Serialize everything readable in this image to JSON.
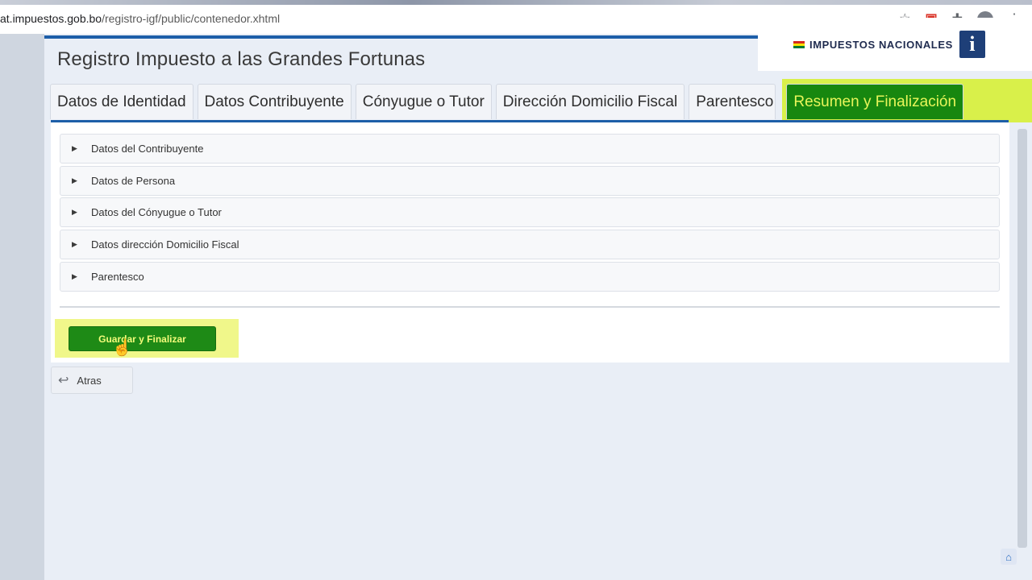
{
  "browser": {
    "url_domain": "at.impuestos.gob.bo",
    "url_path": "/registro-igf/public/contenedor.xhtml",
    "icons": [
      "star-icon",
      "pdf-extension-icon",
      "puzzle-icon",
      "profile-icon",
      "menu-icon"
    ]
  },
  "header": {
    "title": "Registro Impuesto a las Grandes Fortunas",
    "brand": "IMPUESTOS NACIONALES",
    "brand_logo": "i",
    "flag_colors": [
      "#d52b1e",
      "#f9e300",
      "#007934"
    ]
  },
  "tabs": [
    {
      "label": "Datos de Identidad",
      "active": false
    },
    {
      "label": "Datos Contribuyente",
      "active": false
    },
    {
      "label": "Cónyugue o Tutor",
      "active": false
    },
    {
      "label": "Dirección Domicilio Fiscal",
      "active": false
    },
    {
      "label": "Parentesco",
      "active": false
    },
    {
      "label": "Resumen y Finalización",
      "active": true
    }
  ],
  "accordion": [
    {
      "label": "Datos del Contribuyente",
      "expanded": false
    },
    {
      "label": "Datos de Persona",
      "expanded": false
    },
    {
      "label": "Datos del Cónyugue o Tutor",
      "expanded": false
    },
    {
      "label": "Datos dirección Domicilio Fiscal",
      "expanded": false
    },
    {
      "label": "Parentesco",
      "expanded": false
    }
  ],
  "actions": {
    "save_label": "Guardar y Finalizar",
    "back_label": "Atras"
  },
  "colors": {
    "primary_blue": "#1d5ea8",
    "active_green": "#17870f",
    "active_text": "#e8f55a",
    "highlight": "#d9f04a"
  }
}
